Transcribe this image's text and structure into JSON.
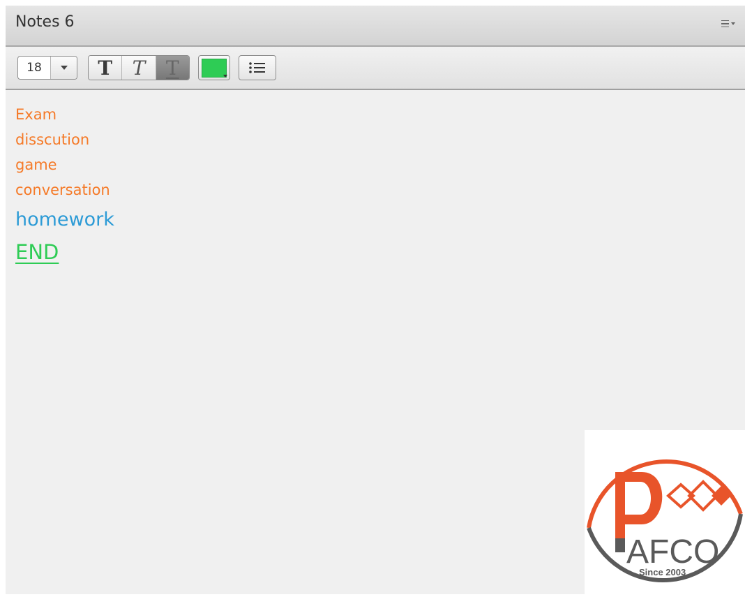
{
  "pod": {
    "title": "Notes 6",
    "menu_icon": "hamburger-menu-icon"
  },
  "toolbar": {
    "font_size": "18",
    "bold_icon": "T",
    "italic_icon": "T",
    "underline_icon": "T",
    "selected_color": "#2ecc55",
    "list_icon": "bulleted-list-icon"
  },
  "notes": {
    "lines": [
      {
        "text": "Exam",
        "color": "#f57a28"
      },
      {
        "text": "disscution",
        "color": "#f57a28"
      },
      {
        "text": "game",
        "color": "#f57a28"
      },
      {
        "text": "conversation",
        "color": "#f57a28"
      },
      {
        "text": "homework",
        "color": "#2d9bd6"
      },
      {
        "text": "END",
        "color": "#2ecc55"
      }
    ]
  },
  "logo": {
    "text": "AFCO",
    "tagline": "Since 2003",
    "brand_color": "#e8542a"
  }
}
